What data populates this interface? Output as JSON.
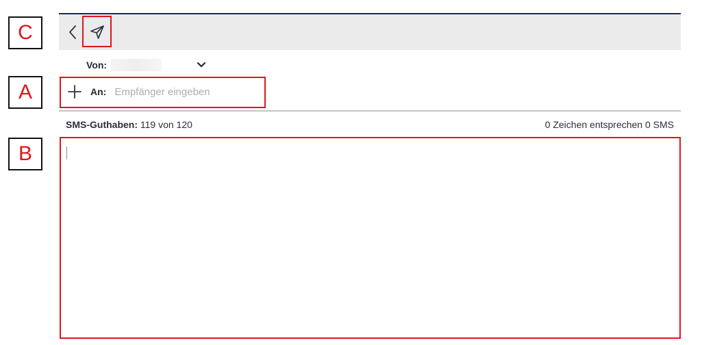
{
  "toolbar": {
    "back_icon": "chevron-left-icon",
    "send_icon": "send-paper-plane-icon"
  },
  "sender": {
    "label": "Von:",
    "chevron_icon": "chevron-down-icon"
  },
  "recipient": {
    "label": "An:",
    "placeholder": "Empfänger eingeben",
    "value": "",
    "add_icon": "plus-icon"
  },
  "status": {
    "credit_label": "SMS-Guthaben:",
    "credit_value": "119 von 120",
    "char_info": "0 Zeichen entsprechen 0 SMS"
  },
  "message": {
    "value": ""
  },
  "annotations": {
    "a": "A",
    "b": "B",
    "c": "C"
  },
  "colors": {
    "annotation_red": "#e0141e",
    "toolbar_bg": "#ebebeb",
    "accent_navy": "#1e2a4a",
    "placeholder_gray": "#a9adb3"
  }
}
